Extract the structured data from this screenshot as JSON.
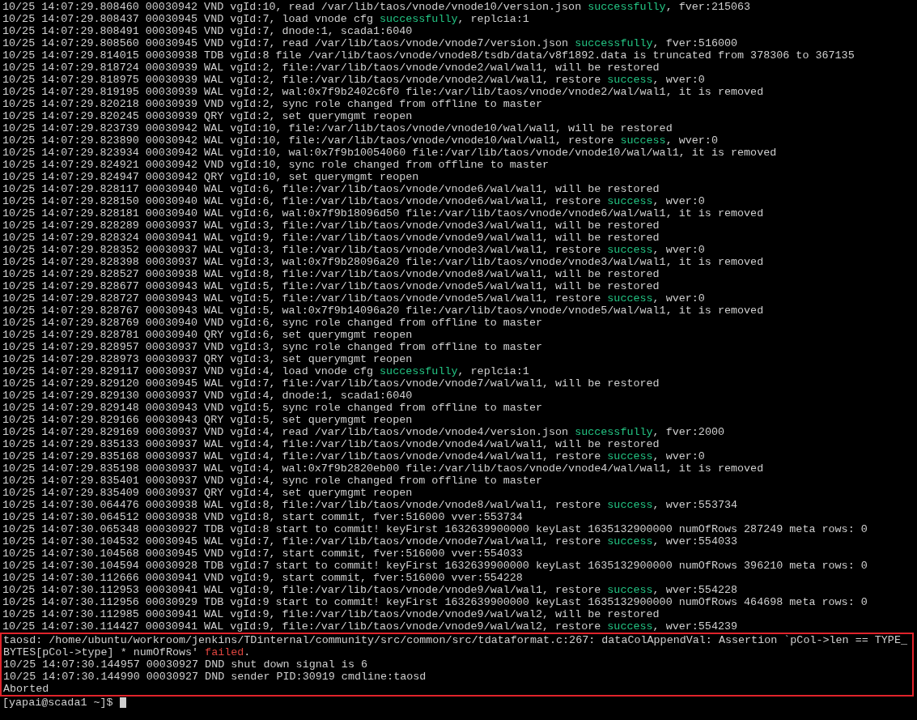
{
  "log_lines": [
    {
      "parts": [
        {
          "text": "10/25 14:07:29.808460 00030942 VND vgId:10, read /var/lib/taos/vnode/vnode10/version.json "
        },
        {
          "text": "successfully",
          "kind": "success"
        },
        {
          "text": ", fver:215063"
        }
      ]
    },
    {
      "parts": [
        {
          "text": "10/25 14:07:29.808437 00030945 VND vgId:7, load vnode cfg "
        },
        {
          "text": "successfully",
          "kind": "success"
        },
        {
          "text": ", replcia:1"
        }
      ]
    },
    {
      "parts": [
        {
          "text": "10/25 14:07:29.808491 00030945 VND vgId:7, dnode:1, scada1:6040"
        }
      ]
    },
    {
      "parts": [
        {
          "text": "10/25 14:07:29.808560 00030945 VND vgId:7, read /var/lib/taos/vnode/vnode7/version.json "
        },
        {
          "text": "successfully",
          "kind": "success"
        },
        {
          "text": ", fver:516000"
        }
      ]
    },
    {
      "parts": [
        {
          "text": "10/25 14:07:29.814015 00030938 TDB vgId:8 file /var/lib/taos/vnode/vnode8/tsdb/data/v8f1892.data is truncated from 378306 to 367135"
        }
      ]
    },
    {
      "parts": [
        {
          "text": "10/25 14:07:29.818724 00030939 WAL vgId:2, file:/var/lib/taos/vnode/vnode2/wal/wal1, will be restored"
        }
      ]
    },
    {
      "parts": [
        {
          "text": "10/25 14:07:29.818975 00030939 WAL vgId:2, file:/var/lib/taos/vnode/vnode2/wal/wal1, restore "
        },
        {
          "text": "success",
          "kind": "success"
        },
        {
          "text": ", wver:0"
        }
      ]
    },
    {
      "parts": [
        {
          "text": "10/25 14:07:29.819195 00030939 WAL vgId:2, wal:0x7f9b2402c6f0 file:/var/lib/taos/vnode/vnode2/wal/wal1, it is removed"
        }
      ]
    },
    {
      "parts": [
        {
          "text": "10/25 14:07:29.820218 00030939 VND vgId:2, sync role changed from offline to master"
        }
      ]
    },
    {
      "parts": [
        {
          "text": "10/25 14:07:29.820245 00030939 QRY vgId:2, set querymgmt reopen"
        }
      ]
    },
    {
      "parts": [
        {
          "text": "10/25 14:07:29.823739 00030942 WAL vgId:10, file:/var/lib/taos/vnode/vnode10/wal/wal1, will be restored"
        }
      ]
    },
    {
      "parts": [
        {
          "text": "10/25 14:07:29.823890 00030942 WAL vgId:10, file:/var/lib/taos/vnode/vnode10/wal/wal1, restore "
        },
        {
          "text": "success",
          "kind": "success"
        },
        {
          "text": ", wver:0"
        }
      ]
    },
    {
      "parts": [
        {
          "text": "10/25 14:07:29.823934 00030942 WAL vgId:10, wal:0x7f9b10054060 file:/var/lib/taos/vnode/vnode10/wal/wal1, it is removed"
        }
      ]
    },
    {
      "parts": [
        {
          "text": "10/25 14:07:29.824921 00030942 VND vgId:10, sync role changed from offline to master"
        }
      ]
    },
    {
      "parts": [
        {
          "text": "10/25 14:07:29.824947 00030942 QRY vgId:10, set querymgmt reopen"
        }
      ]
    },
    {
      "parts": [
        {
          "text": "10/25 14:07:29.828117 00030940 WAL vgId:6, file:/var/lib/taos/vnode/vnode6/wal/wal1, will be restored"
        }
      ]
    },
    {
      "parts": [
        {
          "text": "10/25 14:07:29.828150 00030940 WAL vgId:6, file:/var/lib/taos/vnode/vnode6/wal/wal1, restore "
        },
        {
          "text": "success",
          "kind": "success"
        },
        {
          "text": ", wver:0"
        }
      ]
    },
    {
      "parts": [
        {
          "text": "10/25 14:07:29.828181 00030940 WAL vgId:6, wal:0x7f9b18096d50 file:/var/lib/taos/vnode/vnode6/wal/wal1, it is removed"
        }
      ]
    },
    {
      "parts": [
        {
          "text": "10/25 14:07:29.828289 00030937 WAL vgId:3, file:/var/lib/taos/vnode/vnode3/wal/wal1, will be restored"
        }
      ]
    },
    {
      "parts": [
        {
          "text": "10/25 14:07:29.828324 00030941 WAL vgId:9, file:/var/lib/taos/vnode/vnode9/wal/wal1, will be restored"
        }
      ]
    },
    {
      "parts": [
        {
          "text": "10/25 14:07:29.828352 00030937 WAL vgId:3, file:/var/lib/taos/vnode/vnode3/wal/wal1, restore "
        },
        {
          "text": "success",
          "kind": "success"
        },
        {
          "text": ", wver:0"
        }
      ]
    },
    {
      "parts": [
        {
          "text": "10/25 14:07:29.828398 00030937 WAL vgId:3, wal:0x7f9b28096a20 file:/var/lib/taos/vnode/vnode3/wal/wal1, it is removed"
        }
      ]
    },
    {
      "parts": [
        {
          "text": "10/25 14:07:29.828527 00030938 WAL vgId:8, file:/var/lib/taos/vnode/vnode8/wal/wal1, will be restored"
        }
      ]
    },
    {
      "parts": [
        {
          "text": "10/25 14:07:29.828677 00030943 WAL vgId:5, file:/var/lib/taos/vnode/vnode5/wal/wal1, will be restored"
        }
      ]
    },
    {
      "parts": [
        {
          "text": "10/25 14:07:29.828727 00030943 WAL vgId:5, file:/var/lib/taos/vnode/vnode5/wal/wal1, restore "
        },
        {
          "text": "success",
          "kind": "success"
        },
        {
          "text": ", wver:0"
        }
      ]
    },
    {
      "parts": [
        {
          "text": "10/25 14:07:29.828767 00030943 WAL vgId:5, wal:0x7f9b14096a20 file:/var/lib/taos/vnode/vnode5/wal/wal1, it is removed"
        }
      ]
    },
    {
      "parts": [
        {
          "text": "10/25 14:07:29.828769 00030940 VND vgId:6, sync role changed from offline to master"
        }
      ]
    },
    {
      "parts": [
        {
          "text": "10/25 14:07:29.828781 00030940 QRY vgId:6, set querymgmt reopen"
        }
      ]
    },
    {
      "parts": [
        {
          "text": "10/25 14:07:29.828957 00030937 VND vgId:3, sync role changed from offline to master"
        }
      ]
    },
    {
      "parts": [
        {
          "text": "10/25 14:07:29.828973 00030937 QRY vgId:3, set querymgmt reopen"
        }
      ]
    },
    {
      "parts": [
        {
          "text": "10/25 14:07:29.829117 00030937 VND vgId:4, load vnode cfg "
        },
        {
          "text": "successfully",
          "kind": "success"
        },
        {
          "text": ", replcia:1"
        }
      ]
    },
    {
      "parts": [
        {
          "text": "10/25 14:07:29.829120 00030945 WAL vgId:7, file:/var/lib/taos/vnode/vnode7/wal/wal1, will be restored"
        }
      ]
    },
    {
      "parts": [
        {
          "text": "10/25 14:07:29.829130 00030937 VND vgId:4, dnode:1, scada1:6040"
        }
      ]
    },
    {
      "parts": [
        {
          "text": "10/25 14:07:29.829148 00030943 VND vgId:5, sync role changed from offline to master"
        }
      ]
    },
    {
      "parts": [
        {
          "text": "10/25 14:07:29.829166 00030943 QRY vgId:5, set querymgmt reopen"
        }
      ]
    },
    {
      "parts": [
        {
          "text": "10/25 14:07:29.829169 00030937 VND vgId:4, read /var/lib/taos/vnode/vnode4/version.json "
        },
        {
          "text": "successfully",
          "kind": "success"
        },
        {
          "text": ", fver:2000"
        }
      ]
    },
    {
      "parts": [
        {
          "text": "10/25 14:07:29.835133 00030937 WAL vgId:4, file:/var/lib/taos/vnode/vnode4/wal/wal1, will be restored"
        }
      ]
    },
    {
      "parts": [
        {
          "text": "10/25 14:07:29.835168 00030937 WAL vgId:4, file:/var/lib/taos/vnode/vnode4/wal/wal1, restore "
        },
        {
          "text": "success",
          "kind": "success"
        },
        {
          "text": ", wver:0"
        }
      ]
    },
    {
      "parts": [
        {
          "text": "10/25 14:07:29.835198 00030937 WAL vgId:4, wal:0x7f9b2820eb00 file:/var/lib/taos/vnode/vnode4/wal/wal1, it is removed"
        }
      ]
    },
    {
      "parts": [
        {
          "text": "10/25 14:07:29.835401 00030937 VND vgId:4, sync role changed from offline to master"
        }
      ]
    },
    {
      "parts": [
        {
          "text": "10/25 14:07:29.835409 00030937 QRY vgId:4, set querymgmt reopen"
        }
      ]
    },
    {
      "parts": [
        {
          "text": "10/25 14:07:30.064476 00030938 WAL vgId:8, file:/var/lib/taos/vnode/vnode8/wal/wal1, restore "
        },
        {
          "text": "success",
          "kind": "success"
        },
        {
          "text": ", wver:553734"
        }
      ]
    },
    {
      "parts": [
        {
          "text": "10/25 14:07:30.064512 00030938 VND vgId:8, start commit, fver:516000 vver:553734"
        }
      ]
    },
    {
      "parts": [
        {
          "text": "10/25 14:07:30.065348 00030927 TDB vgId:8 start to commit! keyFirst 1632639900000 keyLast 1635132900000 numOfRows 287249 meta rows: 0"
        }
      ]
    },
    {
      "parts": [
        {
          "text": "10/25 14:07:30.104532 00030945 WAL vgId:7, file:/var/lib/taos/vnode/vnode7/wal/wal1, restore "
        },
        {
          "text": "success",
          "kind": "success"
        },
        {
          "text": ", wver:554033"
        }
      ]
    },
    {
      "parts": [
        {
          "text": "10/25 14:07:30.104568 00030945 VND vgId:7, start commit, fver:516000 vver:554033"
        }
      ]
    },
    {
      "parts": [
        {
          "text": "10/25 14:07:30.104594 00030928 TDB vgId:7 start to commit! keyFirst 1632639900000 keyLast 1635132900000 numOfRows 396210 meta rows: 0"
        }
      ]
    },
    {
      "parts": [
        {
          "text": "10/25 14:07:30.112666 00030941 VND vgId:9, start commit, fver:516000 vver:554228"
        }
      ]
    },
    {
      "parts": [
        {
          "text": "10/25 14:07:30.112953 00030941 WAL vgId:9, file:/var/lib/taos/vnode/vnode9/wal/wal1, restore "
        },
        {
          "text": "success",
          "kind": "success"
        },
        {
          "text": ", wver:554228"
        }
      ]
    },
    {
      "parts": [
        {
          "text": "10/25 14:07:30.112956 00030929 TDB vgId:9 start to commit! keyFirst 1632639900000 keyLast 1635132900000 numOfRows 464698 meta rows: 0"
        }
      ]
    },
    {
      "parts": [
        {
          "text": "10/25 14:07:30.112985 00030941 WAL vgId:9, file:/var/lib/taos/vnode/vnode9/wal/wal2, will be restored"
        }
      ]
    },
    {
      "parts": [
        {
          "text": "10/25 14:07:30.114427 00030941 WAL vgId:9, file:/var/lib/taos/vnode/vnode9/wal/wal2, restore "
        },
        {
          "text": "success",
          "kind": "success"
        },
        {
          "text": ", wver:554239"
        }
      ]
    }
  ],
  "error_block": {
    "lines": [
      {
        "parts": [
          {
            "text": "taosd: /home/ubuntu/workroom/jenkins/TDinternal/community/src/common/src/tdataformat.c:267: dataColAppendVal: Assertion `pCol->len == TYPE_BYTES[pCol->type] * numOfRows' "
          },
          {
            "text": "failed",
            "kind": "failure"
          },
          {
            "text": "."
          }
        ]
      },
      {
        "parts": [
          {
            "text": "10/25 14:07:30.144957 00030927 DND shut down signal is 6"
          }
        ]
      },
      {
        "parts": [
          {
            "text": "10/25 14:07:30.144990 00030927 DND sender PID:30919 cmdline:taosd"
          }
        ]
      },
      {
        "parts": [
          {
            "text": "Aborted"
          }
        ]
      }
    ]
  },
  "prompt": "[yapai@scada1 ~]$"
}
